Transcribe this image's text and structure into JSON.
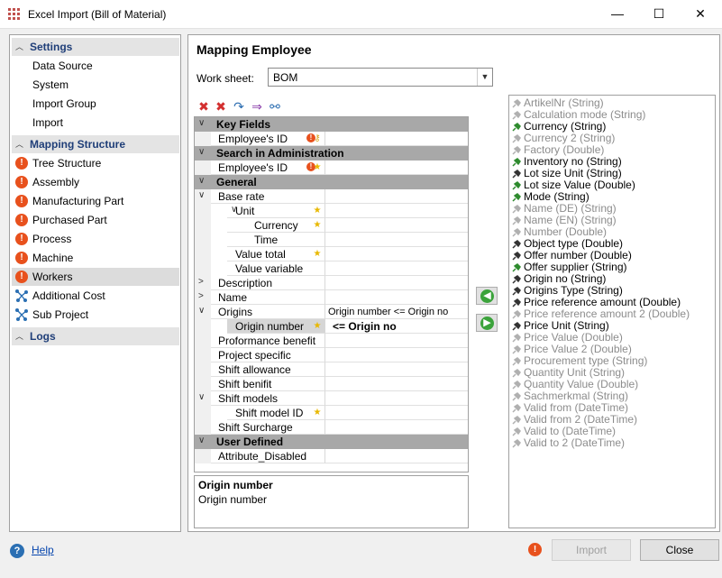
{
  "window": {
    "title": "Excel Import (Bill of Material)",
    "minimize_glyph": "—",
    "maximize_glyph": "☐",
    "close_glyph": "✕"
  },
  "sidebar": {
    "sections": [
      {
        "label": "Settings",
        "items": [
          {
            "label": "Data Source",
            "icon": ""
          },
          {
            "label": "System",
            "icon": ""
          },
          {
            "label": "Import Group",
            "icon": ""
          },
          {
            "label": "Import",
            "icon": ""
          }
        ]
      },
      {
        "label": "Mapping Structure",
        "items": [
          {
            "label": "Tree Structure",
            "icon": "error-icon"
          },
          {
            "label": "Assembly",
            "icon": "error-icon"
          },
          {
            "label": "Manufacturing Part",
            "icon": "error-icon"
          },
          {
            "label": "Purchased Part",
            "icon": "error-icon"
          },
          {
            "label": "Process",
            "icon": "error-icon"
          },
          {
            "label": "Machine",
            "icon": "error-icon"
          },
          {
            "label": "Workers",
            "icon": "error-icon",
            "selected": true
          },
          {
            "label": "Additional Cost",
            "icon": "network-icon"
          },
          {
            "label": "Sub Project",
            "icon": "network-icon"
          }
        ]
      },
      {
        "label": "Logs",
        "items": []
      }
    ]
  },
  "main": {
    "title": "Mapping Employee",
    "worksheet_label": "Work sheet:",
    "worksheet_value": "BOM",
    "toolbar": [
      "delete-icon",
      "delete-all-icon",
      "auto-map-icon",
      "add-attribute-icon",
      "link-icon"
    ],
    "grid_rows": [
      {
        "type": "cat",
        "label": "Key Fields"
      },
      {
        "label": "Employee's ID",
        "indent": 0,
        "ind": "err-key"
      },
      {
        "type": "cat",
        "label": "Search in Administration"
      },
      {
        "label": "Employee's ID",
        "indent": 0,
        "ind": "err-star"
      },
      {
        "type": "cat",
        "label": "General"
      },
      {
        "label": "Base rate",
        "indent": 0,
        "tog": "∨"
      },
      {
        "label": "Unit",
        "indent": 1,
        "tog": "∨",
        "ind": "star"
      },
      {
        "label": "Currency",
        "indent": 3,
        "ind": "star"
      },
      {
        "label": "Time",
        "indent": 3
      },
      {
        "label": "Value total",
        "indent": 2,
        "ind": "star"
      },
      {
        "label": "Value variable",
        "indent": 2
      },
      {
        "label": "Description",
        "indent": 0,
        "tog": ">"
      },
      {
        "label": "Name",
        "indent": 0,
        "tog": ">"
      },
      {
        "label": "Origins",
        "indent": 0,
        "tog": "∨",
        "value": "Origin number <= Origin no"
      },
      {
        "label": "Origin number",
        "indent": 2,
        "ind": "star",
        "value": "<= Origin no",
        "selected": true
      },
      {
        "label": "Proformance benefit",
        "indent": 0
      },
      {
        "label": "Project specific",
        "indent": 0
      },
      {
        "label": "Shift allowance",
        "indent": 0
      },
      {
        "label": "Shift benifit",
        "indent": 0
      },
      {
        "label": "Shift models",
        "indent": 0,
        "tog": "∨"
      },
      {
        "label": "Shift model ID",
        "indent": 2,
        "ind": "star"
      },
      {
        "label": "Shift Surcharge",
        "indent": 0
      },
      {
        "type": "cat",
        "label": "User Defined"
      },
      {
        "label": "Attribute_Disabled",
        "indent": 0
      }
    ],
    "description": {
      "title": "Origin number",
      "text": "Origin number"
    },
    "source_columns": [
      {
        "label": "ArtikelNr   (String)",
        "active": false
      },
      {
        "label": "Calculation mode   (String)",
        "active": false
      },
      {
        "label": "Currency   (String)",
        "active": true,
        "mapped": true
      },
      {
        "label": "Currency 2   (String)",
        "active": false
      },
      {
        "label": "Factory   (Double)",
        "active": false
      },
      {
        "label": "Inventory no   (String)",
        "active": true,
        "mapped": true
      },
      {
        "label": "Lot size Unit   (String)",
        "active": true
      },
      {
        "label": "Lot size Value   (Double)",
        "active": true,
        "mapped": true
      },
      {
        "label": "Mode   (String)",
        "active": true,
        "mapped": true
      },
      {
        "label": "Name (DE)   (String)",
        "active": false
      },
      {
        "label": "Name (EN)   (String)",
        "active": false
      },
      {
        "label": "Number   (Double)",
        "active": false
      },
      {
        "label": "Object type   (Double)",
        "active": true
      },
      {
        "label": "Offer number   (Double)",
        "active": true
      },
      {
        "label": "Offer supplier   (String)",
        "active": true,
        "mapped": true
      },
      {
        "label": "Origin no   (String)",
        "active": true
      },
      {
        "label": "Origins Type   (String)",
        "active": true
      },
      {
        "label": "Price reference amount   (Double)",
        "active": true
      },
      {
        "label": "Price reference amount 2   (Double)",
        "active": false
      },
      {
        "label": "Price Unit   (String)",
        "active": true
      },
      {
        "label": "Price Value   (Double)",
        "active": false
      },
      {
        "label": "Price Value 2   (Double)",
        "active": false
      },
      {
        "label": "Procurement type   (String)",
        "active": false
      },
      {
        "label": "Quantity Unit   (String)",
        "active": false
      },
      {
        "label": "Quantity Value   (Double)",
        "active": false
      },
      {
        "label": "Sachmerkmal   (String)",
        "active": false
      },
      {
        "label": "Valid from   (DateTime)",
        "active": false
      },
      {
        "label": "Valid from 2   (DateTime)",
        "active": false
      },
      {
        "label": "Valid to   (DateTime)",
        "active": false
      },
      {
        "label": "Valid to 2   (DateTime)",
        "active": false
      }
    ]
  },
  "footer": {
    "help_label": "Help",
    "import_label": "Import",
    "close_label": "Close"
  },
  "colors": {
    "accent": "#1f3e78",
    "error": "#e8511d",
    "mapped": "#3ba33b",
    "category": "#a8a8a8"
  }
}
